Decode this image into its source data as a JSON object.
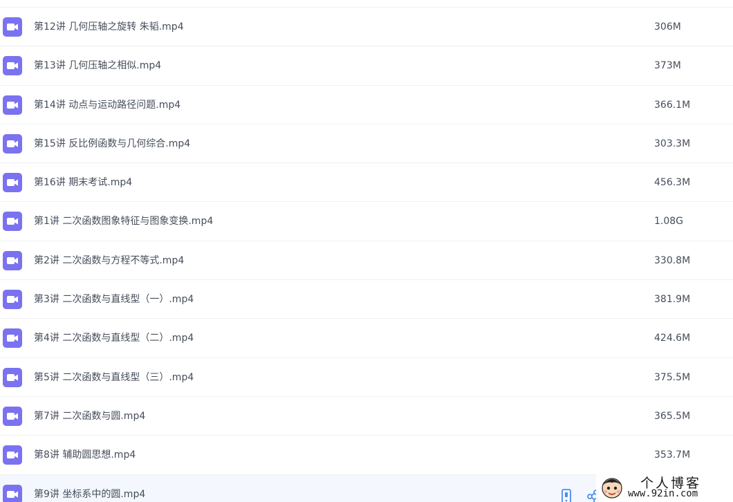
{
  "files": [
    {
      "name": "第12讲 几何压轴之旋转 朱韬.mp4",
      "size": "306M",
      "icon": "video-file-icon"
    },
    {
      "name": "第13讲 几何压轴之相似.mp4",
      "size": "373M",
      "icon": "video-file-icon"
    },
    {
      "name": "第14讲 动点与运动路径问题.mp4",
      "size": "366.1M",
      "icon": "video-file-icon"
    },
    {
      "name": "第15讲 反比例函数与几何综合.mp4",
      "size": "303.3M",
      "icon": "video-file-icon"
    },
    {
      "name": "第16讲 期末考试.mp4",
      "size": "456.3M",
      "icon": "video-file-icon"
    },
    {
      "name": "第1讲 二次函数图象特征与图象变换.mp4",
      "size": "1.08G",
      "icon": "video-file-icon"
    },
    {
      "name": "第2讲 二次函数与方程不等式.mp4",
      "size": "330.8M",
      "icon": "video-file-icon"
    },
    {
      "name": "第3讲 二次函数与直线型（一）.mp4",
      "size": "381.9M",
      "icon": "video-file-icon"
    },
    {
      "name": "第4讲 二次函数与直线型（二）.mp4",
      "size": "424.6M",
      "icon": "video-file-icon"
    },
    {
      "name": "第5讲 二次函数与直线型（三）.mp4",
      "size": "375.5M",
      "icon": "video-file-icon"
    },
    {
      "name": "第7讲 二次函数与圆.mp4",
      "size": "365.5M",
      "icon": "video-file-icon"
    },
    {
      "name": "第8讲 辅助圆思想.mp4",
      "size": "353.7M",
      "icon": "video-file-icon"
    },
    {
      "name": "第9讲 坐标系中的圆.mp4",
      "size": "",
      "icon": "video-file-icon",
      "hovered": true
    }
  ],
  "hover_actions": [
    {
      "icon": "phone-icon"
    },
    {
      "icon": "share-icon"
    }
  ],
  "watermark": {
    "title": "个人博客",
    "url": "www.92in.com"
  },
  "colors": {
    "video_icon": "#7b72f0",
    "text": "#454d5a",
    "divider": "#eef0f4",
    "hover_row": "#f4f8fe",
    "action_icon": "#4a8df0"
  }
}
